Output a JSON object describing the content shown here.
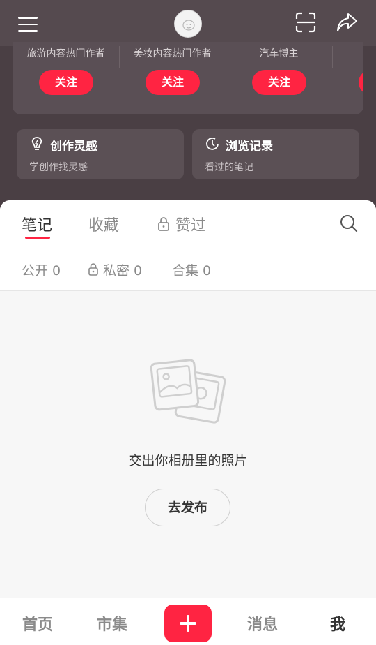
{
  "header": {
    "menu_icon": "hamburger-icon",
    "scan_icon": "scan-icon",
    "share_icon": "share-icon"
  },
  "creators": [
    {
      "label": "旅游内容热门作者",
      "follow": "关注"
    },
    {
      "label": "美妆内容热门作者",
      "follow": "关注"
    },
    {
      "label": "汽车博主",
      "follow": "关注"
    },
    {
      "label": "",
      "follow": ""
    }
  ],
  "cards": {
    "inspiration": {
      "title": "创作灵感",
      "sub": "学创作找灵感"
    },
    "history": {
      "title": "浏览记录",
      "sub": "看过的笔记"
    }
  },
  "tabs": {
    "notes": "笔记",
    "favorites": "收藏",
    "liked": "赞过"
  },
  "subtabs": {
    "public": "公开 0",
    "private": "私密 0",
    "collections": "合集 0"
  },
  "empty": {
    "text": "交出你相册里的照片",
    "button": "去发布"
  },
  "bottom_nav": {
    "home": "首页",
    "market": "市集",
    "messages": "消息",
    "me": "我"
  },
  "colors": {
    "accent": "#ff2442",
    "dark_bg": "#4a3f44"
  }
}
